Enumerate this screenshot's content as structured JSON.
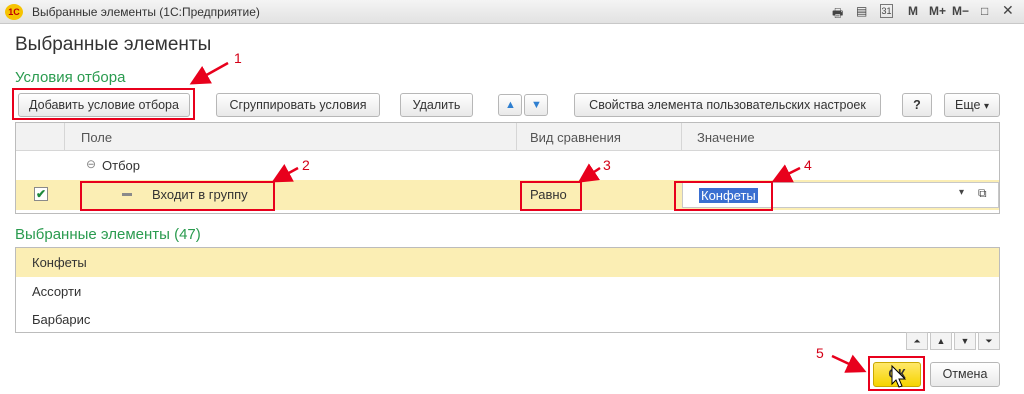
{
  "window": {
    "title": "Выбранные элементы  (1С:Предприятие)",
    "logo_text": "1С",
    "toolbar_buttons": [
      "M",
      "M+",
      "M−"
    ],
    "calendar_label": "31"
  },
  "form": {
    "title": "Выбранные элементы",
    "filter_section_title": "Условия отбора",
    "selected_section_title": "Выбранные элементы (47)"
  },
  "toolbar": {
    "add_condition": "Добавить условие отбора",
    "group_conditions": "Сгруппировать условия",
    "delete": "Удалить",
    "user_settings_props": "Свойства элемента пользовательских настроек",
    "help": "?",
    "more": "Еще",
    "more_chevron": "▾"
  },
  "grid": {
    "headers": [
      "Поле",
      "Вид сравнения",
      "Значение"
    ],
    "group_row": {
      "toggle": "⊖",
      "label": "Отбор"
    },
    "condition_row": {
      "checked": true,
      "check_glyph": "✔",
      "field": "Входит в группу",
      "comparison": "Равно",
      "value": "Конфеты",
      "dropdown_glyph": "▾",
      "open_glyph": "⧉"
    }
  },
  "selected_items": [
    "Конфеты",
    "Ассорти",
    "Барбарис"
  ],
  "list_nav": [
    "⏶",
    "▲",
    "▼",
    "⏷"
  ],
  "footer": {
    "ok": "ОК",
    "cancel": "Отмена"
  },
  "annotations": [
    "1",
    "2",
    "3",
    "4",
    "5"
  ],
  "colors": {
    "section_green": "#2a9b4f",
    "selection_yellow": "#fbeeb4",
    "annotation_red": "#e8001c",
    "ok_yellow": "#f6d400"
  }
}
